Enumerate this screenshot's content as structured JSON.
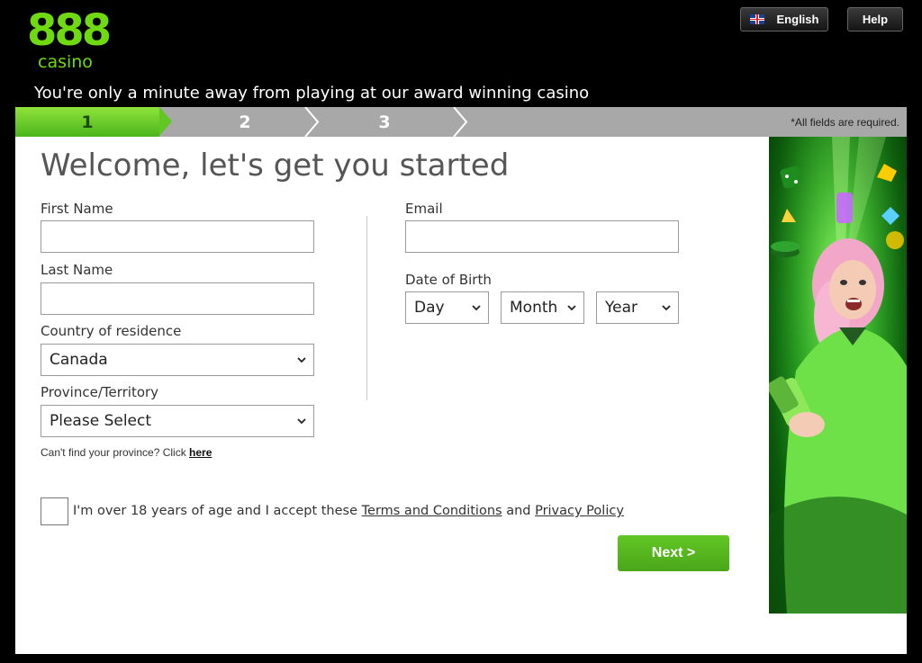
{
  "brand": {
    "logo_number": "888",
    "logo_word": "casino"
  },
  "header": {
    "language_label": "English",
    "help_label": "Help",
    "tagline": "You're only a minute away from playing at our award winning casino"
  },
  "steps": {
    "items": [
      "1",
      "2",
      "3"
    ],
    "active": 1,
    "required_note": "*All fields are required."
  },
  "form": {
    "title": "Welcome, let's get you started",
    "first_name_label": "First Name",
    "last_name_label": "Last Name",
    "country_label": "Country of residence",
    "country_value": "Canada",
    "province_label": "Province/Territory",
    "province_value": "Please Select",
    "province_note": "Can't find your province? Click",
    "province_note_link": "here",
    "email_label": "Email",
    "dob_label": "Date of Birth",
    "dob_day": "Day",
    "dob_month": "Month",
    "dob_year": "Year",
    "terms_prefix": "I'm over 18 years of age and I accept these",
    "terms_link": "Terms and Conditions",
    "terms_and": "and",
    "privacy_link": "Privacy Policy",
    "next_label": "Next >"
  },
  "colors": {
    "brand_green": "#6fda12",
    "button_green": "#56b81f",
    "step_gray": "#a8a8a8"
  }
}
